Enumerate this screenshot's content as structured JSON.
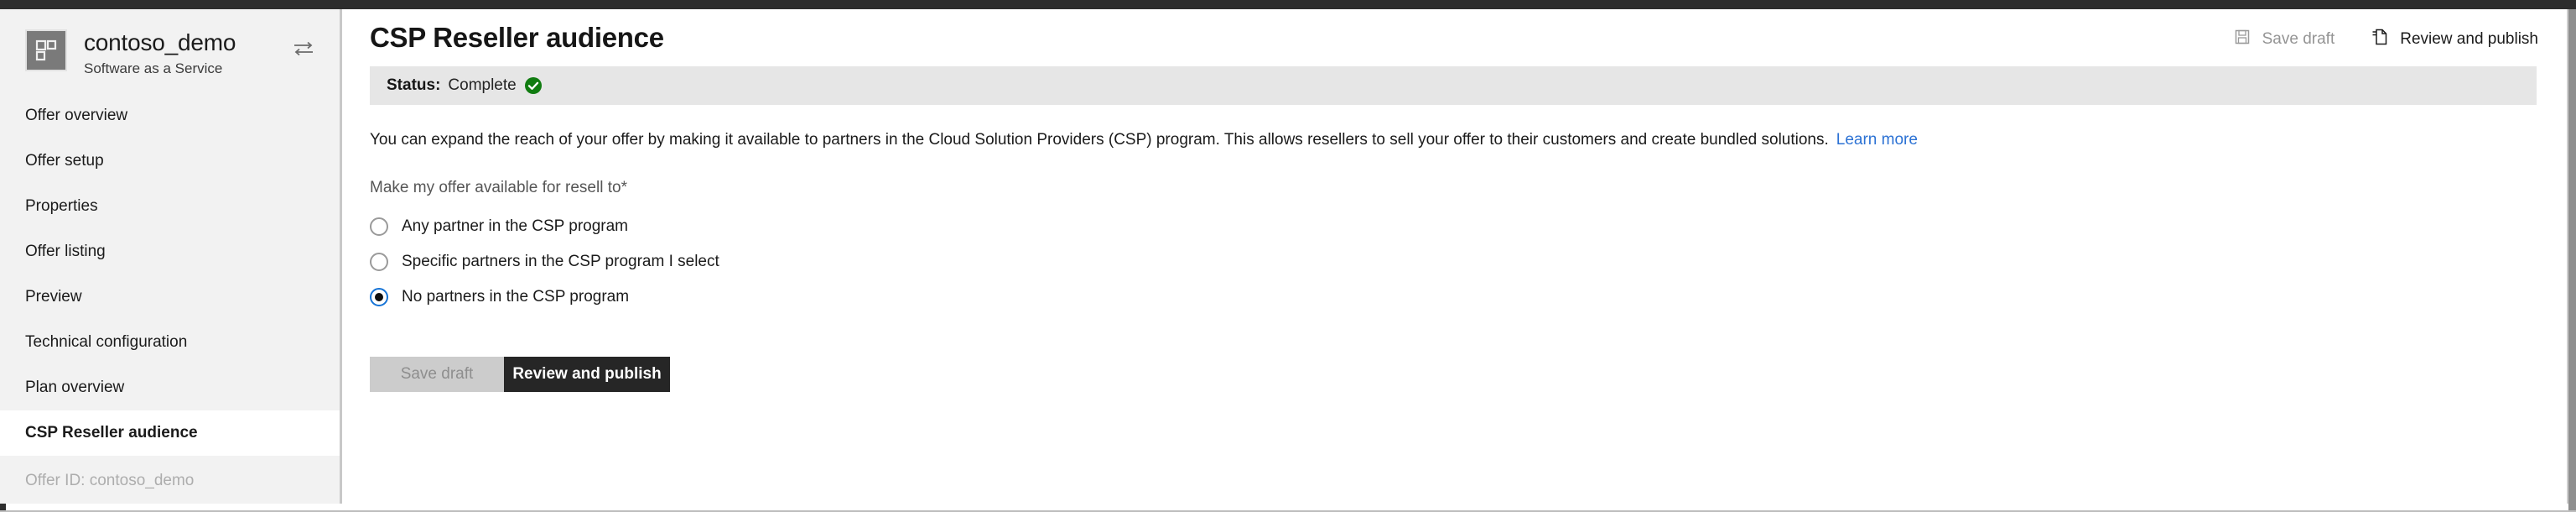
{
  "window": {
    "chrome_color": "#2d2d2d"
  },
  "sidebar": {
    "offer_name": "contoso_demo",
    "offer_type": "Software as a Service",
    "offer_icon": "grid-squares-icon",
    "switch_icon": "switch-offer-icon",
    "items": [
      {
        "label": "Offer overview",
        "selected": false
      },
      {
        "label": "Offer setup",
        "selected": false
      },
      {
        "label": "Properties",
        "selected": false
      },
      {
        "label": "Offer listing",
        "selected": false
      },
      {
        "label": "Preview",
        "selected": false
      },
      {
        "label": "Technical configuration",
        "selected": false
      },
      {
        "label": "Plan overview",
        "selected": false
      },
      {
        "label": "CSP Reseller audience",
        "selected": true
      }
    ],
    "offer_id_text": "Offer ID: contoso_demo"
  },
  "header": {
    "title": "CSP Reseller audience",
    "save_draft_label": "Save draft",
    "save_draft_icon": "save-disk-icon",
    "save_draft_disabled": true,
    "review_publish_label": "Review and publish",
    "review_publish_icon": "publish-page-icon"
  },
  "status": {
    "label": "Status:",
    "value": "Complete",
    "icon": "green-check-circle-icon",
    "color": "#107c10"
  },
  "main": {
    "intro_text": "You can expand the reach of your offer by making it available to partners in the Cloud Solution Providers (CSP) program. This allows resellers to sell your offer to their customers and create bundled solutions.",
    "learn_more_label": "Learn more",
    "learn_more_color": "#2c72d4",
    "field_label": "Make my offer available for resell to",
    "required_marker": "*",
    "options": [
      {
        "label": "Any partner in the CSP program",
        "checked": false
      },
      {
        "label": "Specific partners in the CSP program I select",
        "checked": false
      },
      {
        "label": "No partners in the CSP program",
        "checked": true
      }
    ]
  },
  "footer": {
    "save_draft_label": "Save draft",
    "save_draft_disabled": true,
    "review_publish_label": "Review and publish"
  },
  "colors": {
    "accent_blue": "#1573d6",
    "status_green": "#107c10",
    "dark_button": "#262626",
    "sidebar_bg": "#f2f2f2",
    "status_bar_bg": "#e6e6e6"
  }
}
